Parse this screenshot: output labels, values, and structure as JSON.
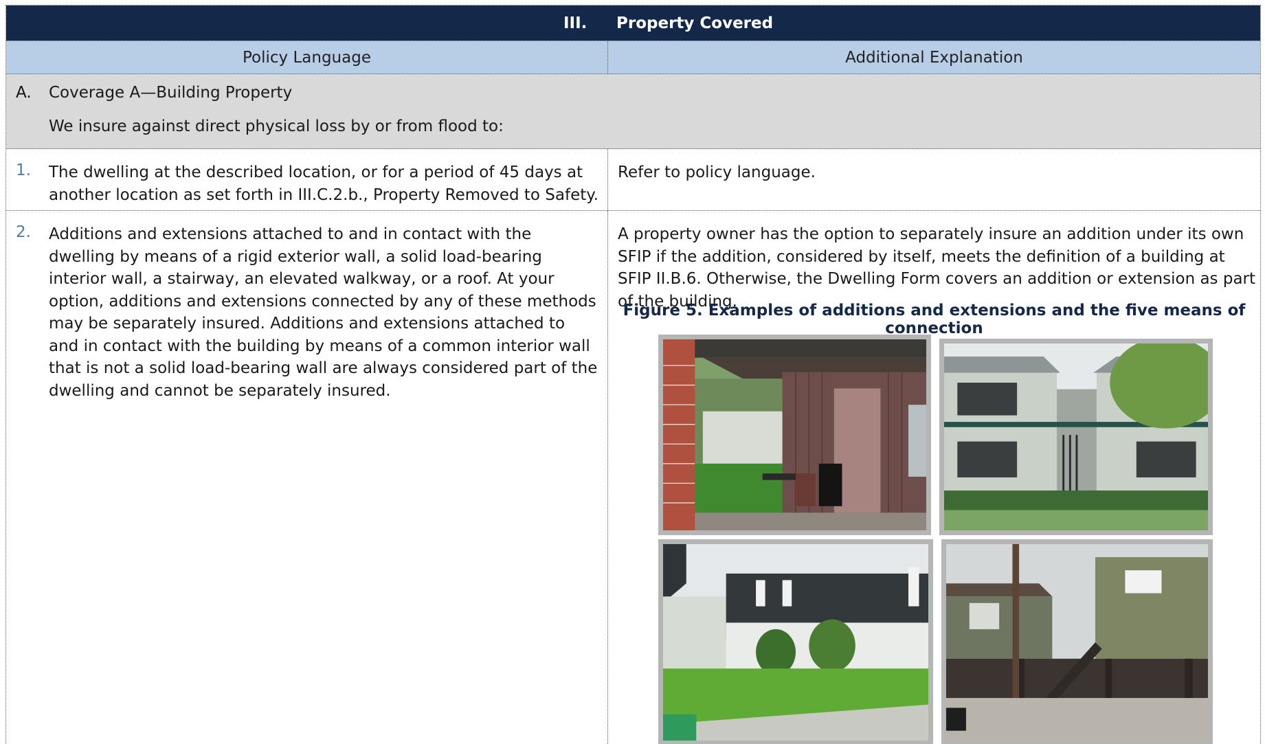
{
  "section": {
    "number": "III.",
    "title": "Property Covered"
  },
  "columns": {
    "left": "Policy Language",
    "right": "Additional Explanation"
  },
  "coverage_a": {
    "letter": "A.",
    "heading": "Coverage A—Building Property",
    "intro": "We insure against direct physical loss by or from flood to:"
  },
  "rows": [
    {
      "number": "1.",
      "policy": "The dwelling at the described location, or for a period of 45 days at another location as set forth in III.C.2.b., Property Removed to Safety.",
      "explanation": "Refer to policy language."
    },
    {
      "number": "2.",
      "policy": "Additions and extensions attached to and in contact with the dwelling by means of a rigid exterior wall, a solid load-bearing interior wall, a stairway, an elevated walkway, or a roof. At your option, additions and extensions connected by any of these methods may be separately insured. Additions and extensions attached to and in contact with the building by means of a common interior wall that is not a solid load-bearing wall are always considered part of the dwelling and cannot be separately insured.",
      "explanation": "A property owner has the option to separately insure an addition under its own SFIP if the addition, considered by itself, meets the definition of a building at SFIP II.B.6. Otherwise, the Dwelling Form covers an addition or extension as part of the building.",
      "figure_caption": "Figure 5. Examples of additions and extensions and the five means of connection"
    }
  ],
  "colors": {
    "header_bg": "#14294a",
    "column_header_bg": "#b8cde6",
    "coverage_bg": "#d9d9d9",
    "number_color": "#4f7fa0"
  }
}
